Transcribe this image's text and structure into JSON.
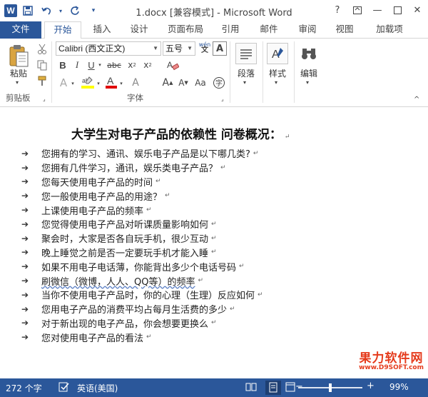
{
  "window": {
    "title": "1.docx [兼容模式] - Microsoft Word"
  },
  "tabs": [
    {
      "label": "文件"
    },
    {
      "label": "开始"
    },
    {
      "label": "插入"
    },
    {
      "label": "设计"
    },
    {
      "label": "页面布局"
    },
    {
      "label": "引用"
    },
    {
      "label": "邮件"
    },
    {
      "label": "审阅"
    },
    {
      "label": "视图"
    },
    {
      "label": "加载项"
    }
  ],
  "ribbon": {
    "clipboard": {
      "paste_label": "粘贴",
      "group_label": "剪贴板"
    },
    "font": {
      "font_name": "Calibri (西文正文)",
      "font_size": "五号",
      "group_label": "字体",
      "phonetic": "wén"
    },
    "paragraph": {
      "label": "段落"
    },
    "styles": {
      "label": "样式"
    },
    "editing": {
      "label": "编辑"
    }
  },
  "document": {
    "heading": "大学生对电子产品的依赖性  问卷概况：",
    "items": [
      "您拥有的学习、通讯、娱乐电子产品是以下哪几类?",
      "您拥有几件学习，通讯，娱乐类电子产品？",
      "您每天使用电子产品的时间",
      "您一般使用电子产品的用途？",
      "上课使用电子产品的频率",
      "您觉得使用电子产品对听课质量影响如何",
      "聚会时，大家是否各自玩手机，很少互动",
      "晚上睡觉之前是否一定要玩手机才能入睡",
      "如果不用电子电话薄，你能背出多少个电话号码",
      "刷微信（微博，人人、QQ等）的频率",
      "当你不使用电子产品时，你的心理（生理）反应如何",
      "您用电子产品的消费平均占每月生活费的多少",
      "对于新出现的电子产品，你会想要更换么",
      "您对使用电子产品的看法"
    ]
  },
  "watermark": {
    "main": "果力软件网",
    "sub": "www.D9SOFT.com"
  },
  "statusbar": {
    "word_count": "272 个字",
    "language": "英语(美国)",
    "zoom": "99%"
  },
  "colors": {
    "accent": "#2b579a",
    "watermark": "#e53b1c"
  }
}
